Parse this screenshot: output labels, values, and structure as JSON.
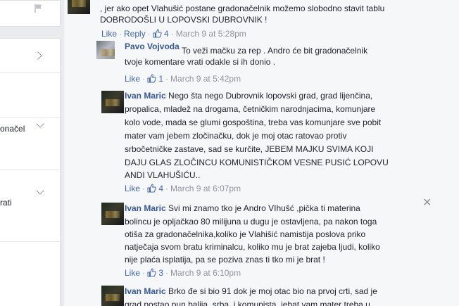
{
  "left_panel": {
    "items": [
      {
        "label": ""
      },
      {
        "label": ""
      },
      {
        "label": "onačel"
      },
      {
        "label": "rati"
      }
    ]
  },
  "comments": [
    {
      "lines": [
        ", jer ako opet Vlahušić postane gradonačelnik možemo slobodno stavit tablu",
        "DOBRODOŠLI U LOPOVSKI DUBROVNIK !"
      ],
      "like": "Like",
      "reply": "Reply",
      "likes": "4",
      "time": "March 9 at 5:28pm"
    },
    {
      "author": "Pavo Vojvoda",
      "lines": [
        "To veži mačku za rep .  Andro će bit gradonačelnik",
        "tvoje komentare vrati odakle si ih donio ."
      ],
      "like": "Like",
      "likes": "1",
      "time": "March 9 at 5:42pm"
    },
    {
      "author": "Ivan Maric",
      "lines": [
        "Nego šta nego Dubrovnik lopovski grad, grad lijenčina,",
        "propalica, mladež na drogama, četničkim narodnjacima, komunjare",
        "kolo vode, mada se glumi gospoština, treba vas komunjare sve pobit",
        "mater vam jebem zločinačku, dok je moj otac ratovao protiv",
        "srbočetničke zastave, sad se kurčite, JEBEM MAJKU SVIMA KOJI",
        "DAJU GLAS ZLOČINCU KOMUNISTIČKOM VESNE PUSIĆ LOPOVU",
        "ANDI VLAHUŠIĆU.."
      ],
      "like": "Like",
      "likes": "4",
      "time": "March 9 at 6:07pm"
    },
    {
      "author": "Ivan Maric",
      "lines": [
        "Svi mi znamo tko je Andro VIhušć ,pička ti materina",
        "bolincu je opljačkao 80 milijuna u dugu je ostavljena, pa nakon toga",
        "otiša za gradonačelnika,koliko je Vlahišić namistija poslova priko",
        "natječaja svom bratu kriminalcu, koliko mu je brat zajeba ljudi, koliko",
        "nije plaća isplatija, pa se poziva znas ti tko mi je brat !"
      ],
      "like": "Like",
      "likes": "3",
      "time": "March 9 at 6:10pm"
    },
    {
      "author": "Ivan Maric",
      "lines": [
        "Brko đe si bio 91 dok je moj otac bio na prvoj crti, sad je",
        "grad postao pun balija, srba, i komunista, jebat vam mater treba u"
      ]
    }
  ],
  "icons": {
    "flag": "flag-icon",
    "chevron": "chevron-right-icon",
    "close": "close-icon"
  },
  "colors": {
    "link": "#4267b2",
    "author": "#365899",
    "meta": "#90949c"
  }
}
